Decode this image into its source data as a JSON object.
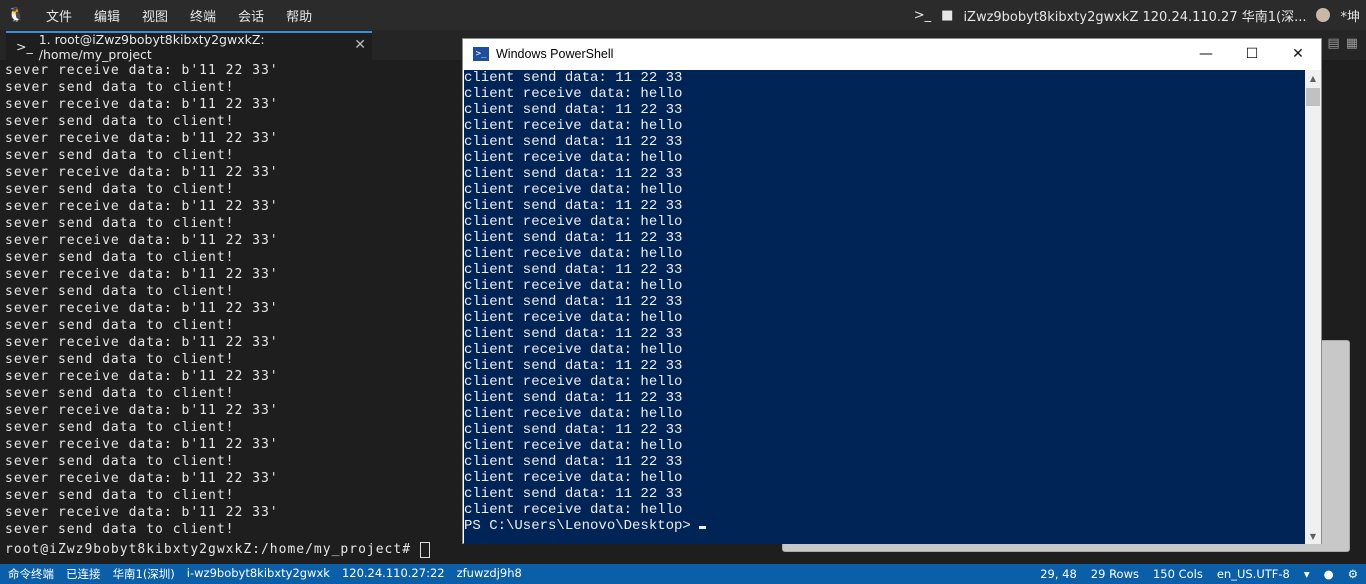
{
  "menubar": {
    "logo_icon": "linux-penguin-icon",
    "items": [
      "文件",
      "编辑",
      "视图",
      "终端",
      "会话",
      "帮助"
    ],
    "session_prompt": ">_",
    "session_label": "iZwz9bobyt8kibxty2gwxkZ 120.24.110.27 华南1(深...",
    "user": "*坤"
  },
  "tab": {
    "prefix": ">_",
    "title": "1. root@iZwz9bobyt8kibxty2gwxkZ: /home/my_project",
    "close": "✕"
  },
  "terminal": {
    "lines": [
      "sever receive data: b'11 22 33'",
      "sever send data to client!",
      "sever receive data: b'11 22 33'",
      "sever send data to client!",
      "sever receive data: b'11 22 33'",
      "sever send data to client!",
      "sever receive data: b'11 22 33'",
      "sever send data to client!",
      "sever receive data: b'11 22 33'",
      "sever send data to client!",
      "sever receive data: b'11 22 33'",
      "sever send data to client!",
      "sever receive data: b'11 22 33'",
      "sever send data to client!",
      "sever receive data: b'11 22 33'",
      "sever send data to client!",
      "sever receive data: b'11 22 33'",
      "sever send data to client!",
      "sever receive data: b'11 22 33'",
      "sever send data to client!",
      "sever receive data: b'11 22 33'",
      "sever send data to client!",
      "sever receive data: b'11 22 33'",
      "sever send data to client!",
      "sever receive data: b'11 22 33'",
      "sever send data to client!",
      "sever receive data: b'11 22 33'",
      "sever send data to client!"
    ],
    "prompt": "root@iZwz9bobyt8kibxty2gwxkZ:/home/my_project# "
  },
  "powershell": {
    "title": "Windows PowerShell",
    "minimize": "—",
    "maximize": "☐",
    "close": "✕",
    "lines": [
      "client send data: 11 22 33",
      "client receive data: hello",
      "client send data: 11 22 33",
      "client receive data: hello",
      "client send data: 11 22 33",
      "client receive data: hello",
      "client send data: 11 22 33",
      "client receive data: hello",
      "client send data: 11 22 33",
      "client receive data: hello",
      "client send data: 11 22 33",
      "client receive data: hello",
      "client send data: 11 22 33",
      "client receive data: hello",
      "client send data: 11 22 33",
      "client receive data: hello",
      "client send data: 11 22 33",
      "client receive data: hello",
      "client send data: 11 22 33",
      "client receive data: hello",
      "client send data: 11 22 33",
      "client receive data: hello",
      "client send data: 11 22 33",
      "client receive data: hello",
      "client send data: 11 22 33",
      "client receive data: hello",
      "client send data: 11 22 33",
      "client receive data: hello"
    ],
    "prompt": "PS C:\\Users\\Lenovo\\Desktop> "
  },
  "statusbar": {
    "left": [
      "命令终端",
      "已连接",
      "华南1(深圳)",
      "i-wz9bobyt8kibxty2gwxk",
      "120.24.110.27:22",
      "zfuwzdj9h8"
    ],
    "cursor_pos": "29, 48",
    "rows": "29 Rows",
    "cols": "150 Cols",
    "encoding": "en_US.UTF-8"
  },
  "colors": {
    "powershell_bg": "#012456",
    "statusbar_bg": "#0a5fa8",
    "tab_accent": "#3c8dde"
  }
}
